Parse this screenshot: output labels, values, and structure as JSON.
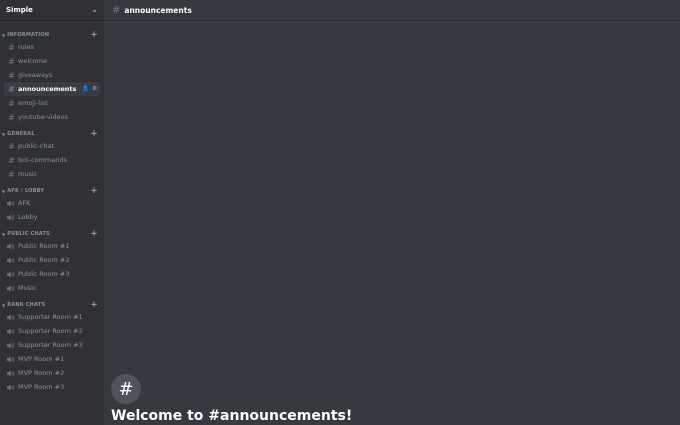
{
  "server": {
    "name": "Simple"
  },
  "categories": [
    {
      "name": "INFORMATION",
      "channels": [
        {
          "type": "text",
          "name": "rules"
        },
        {
          "type": "text",
          "name": "welcome"
        },
        {
          "type": "text",
          "name": "giveaways"
        },
        {
          "type": "text",
          "name": "announcements",
          "active": true
        },
        {
          "type": "text",
          "name": "emoji-list"
        },
        {
          "type": "text",
          "name": "youtube-videos"
        }
      ]
    },
    {
      "name": "GENERAL",
      "channels": [
        {
          "type": "text",
          "name": "public-chat"
        },
        {
          "type": "text",
          "name": "bot-commands"
        },
        {
          "type": "text",
          "name": "music"
        }
      ]
    },
    {
      "name": "AFK / LOBBY",
      "channels": [
        {
          "type": "voice",
          "name": "AFK"
        },
        {
          "type": "voice",
          "name": "Lobby"
        }
      ]
    },
    {
      "name": "PUBLIC CHATS",
      "channels": [
        {
          "type": "voice",
          "name": "Public Room #1"
        },
        {
          "type": "voice",
          "name": "Public Room #2"
        },
        {
          "type": "voice",
          "name": "Public Room #3"
        },
        {
          "type": "voice",
          "name": "Music"
        }
      ]
    },
    {
      "name": "RANK CHATS",
      "channels": [
        {
          "type": "voice",
          "name": "Supporter Room #1"
        },
        {
          "type": "voice",
          "name": "Supporter Room #2"
        },
        {
          "type": "voice",
          "name": "Supporter Room #3"
        },
        {
          "type": "voice",
          "name": "MVP Room #1"
        },
        {
          "type": "voice",
          "name": "MVP Room #2"
        },
        {
          "type": "voice",
          "name": "MVP Room #3"
        }
      ]
    }
  ],
  "topbar": {
    "channel": "announcements"
  },
  "welcome": {
    "title": "Welcome to #announcements!"
  },
  "colors": {
    "sidebar": "#2f3136",
    "main": "#36393f",
    "active": "#393c43",
    "muted": "#8e9297"
  }
}
